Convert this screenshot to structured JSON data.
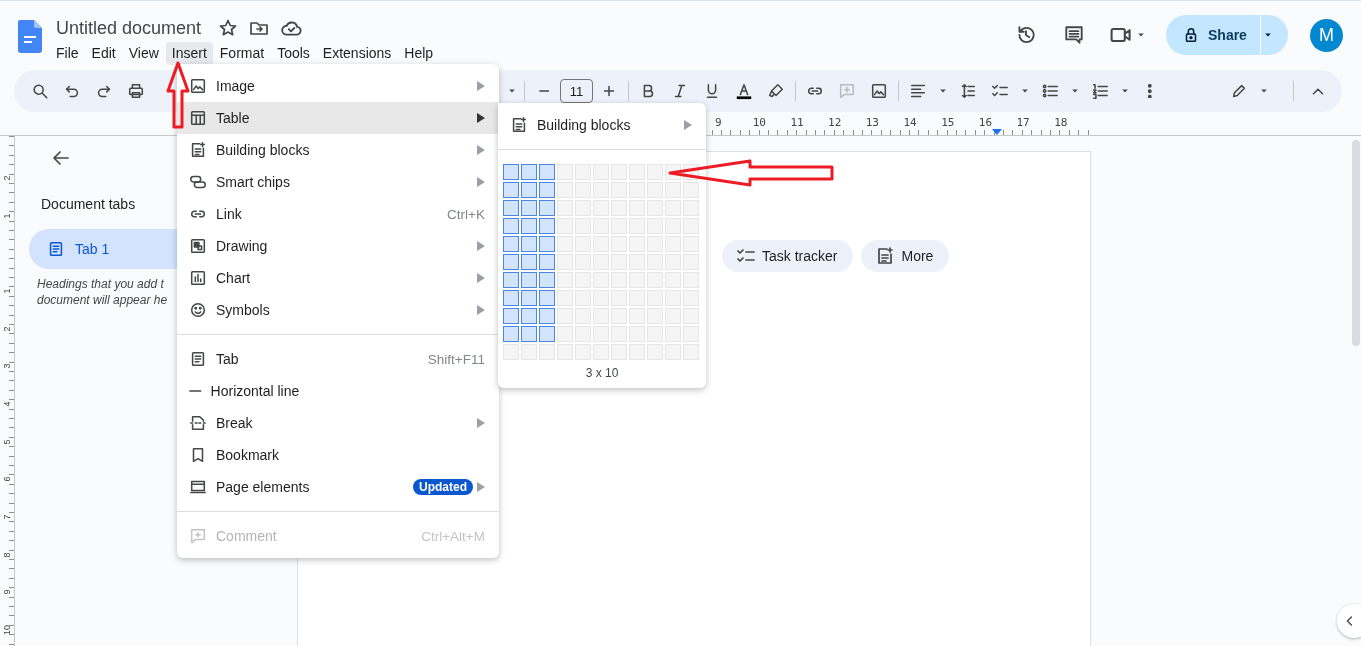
{
  "app": {
    "title": "Untitled document",
    "menu_bar": [
      {
        "label": "File",
        "selected": false
      },
      {
        "label": "Edit",
        "selected": false
      },
      {
        "label": "View",
        "selected": false
      },
      {
        "label": "Insert",
        "selected": true
      },
      {
        "label": "Format",
        "selected": false
      },
      {
        "label": "Tools",
        "selected": false
      },
      {
        "label": "Extensions",
        "selected": false
      },
      {
        "label": "Help",
        "selected": false
      }
    ]
  },
  "header_actions": {
    "share": "Share",
    "avatar": "M"
  },
  "toolbar": {
    "font_size": "11"
  },
  "ruler": {
    "labels": [
      "9",
      "10",
      "11",
      "12",
      "13",
      "14",
      "15",
      "16",
      "17",
      "18"
    ]
  },
  "vertical_ruler": {
    "labels": [
      "2",
      "1",
      "1",
      "2",
      "3",
      "4",
      "5",
      "6",
      "7",
      "8",
      "9",
      "10"
    ]
  },
  "sidebar": {
    "title": "Document tabs",
    "tabs": [
      {
        "label": "Tab 1",
        "selected": true
      }
    ],
    "hint_lines": [
      "Headings that you add t",
      "document will appear he"
    ]
  },
  "document": {
    "chips": [
      {
        "label": "Task tracker"
      },
      {
        "label": "More"
      }
    ]
  },
  "insert_menu": {
    "items": [
      {
        "kind": "item",
        "label": "Image",
        "submenu": true,
        "selected": false,
        "disabled": false
      },
      {
        "kind": "item",
        "label": "Table",
        "submenu": true,
        "selected": true,
        "disabled": false
      },
      {
        "kind": "item",
        "label": "Building blocks",
        "submenu": true,
        "selected": false,
        "disabled": false
      },
      {
        "kind": "item",
        "label": "Smart chips",
        "submenu": true,
        "selected": false,
        "disabled": false
      },
      {
        "kind": "item",
        "label": "Link",
        "shortcut": "Ctrl+K",
        "submenu": false,
        "selected": false,
        "disabled": false
      },
      {
        "kind": "item",
        "label": "Drawing",
        "submenu": true,
        "selected": false,
        "disabled": false
      },
      {
        "kind": "item",
        "label": "Chart",
        "submenu": true,
        "selected": false,
        "disabled": false
      },
      {
        "kind": "item",
        "label": "Symbols",
        "submenu": true,
        "selected": false,
        "disabled": false
      },
      {
        "kind": "divider"
      },
      {
        "kind": "item",
        "label": "Tab",
        "shortcut": "Shift+F11",
        "submenu": false,
        "selected": false,
        "disabled": false
      },
      {
        "kind": "item",
        "label": "Horizontal line",
        "submenu": false,
        "selected": false,
        "disabled": false
      },
      {
        "kind": "item",
        "label": "Break",
        "submenu": true,
        "selected": false,
        "disabled": false
      },
      {
        "kind": "item",
        "label": "Bookmark",
        "submenu": false,
        "selected": false,
        "disabled": false
      },
      {
        "kind": "item",
        "label": "Page elements",
        "badge": "Updated",
        "submenu": true,
        "selected": false,
        "disabled": false
      },
      {
        "kind": "divider"
      },
      {
        "kind": "item",
        "label": "Comment",
        "shortcut": "Ctrl+Alt+M",
        "submenu": false,
        "selected": false,
        "disabled": true
      }
    ]
  },
  "table_submenu": {
    "items": [
      {
        "label": "Building blocks",
        "submenu": true
      }
    ],
    "size_label": "3 x 10",
    "grid": [
      [
        true,
        true,
        true,
        false,
        false,
        false,
        false,
        false,
        false,
        false,
        false
      ],
      [
        true,
        true,
        true,
        false,
        false,
        false,
        false,
        false,
        false,
        false,
        false
      ],
      [
        true,
        true,
        true,
        false,
        false,
        false,
        false,
        false,
        false,
        false,
        false
      ],
      [
        true,
        true,
        true,
        false,
        false,
        false,
        false,
        false,
        false,
        false,
        false
      ],
      [
        true,
        true,
        true,
        false,
        false,
        false,
        false,
        false,
        false,
        false,
        false
      ],
      [
        true,
        true,
        true,
        false,
        false,
        false,
        false,
        false,
        false,
        false,
        false
      ],
      [
        true,
        true,
        true,
        false,
        false,
        false,
        false,
        false,
        false,
        false,
        false
      ],
      [
        true,
        true,
        true,
        false,
        false,
        false,
        false,
        false,
        false,
        false,
        false
      ],
      [
        true,
        true,
        true,
        false,
        false,
        false,
        false,
        false,
        false,
        false,
        false
      ],
      [
        true,
        true,
        true,
        false,
        false,
        false,
        false,
        false,
        false,
        false,
        false
      ],
      [
        false,
        false,
        false,
        false,
        false,
        false,
        false,
        false,
        false,
        false,
        false
      ]
    ]
  },
  "annotations": [
    {
      "kind": "arrow-up"
    },
    {
      "kind": "arrow-left"
    }
  ]
}
